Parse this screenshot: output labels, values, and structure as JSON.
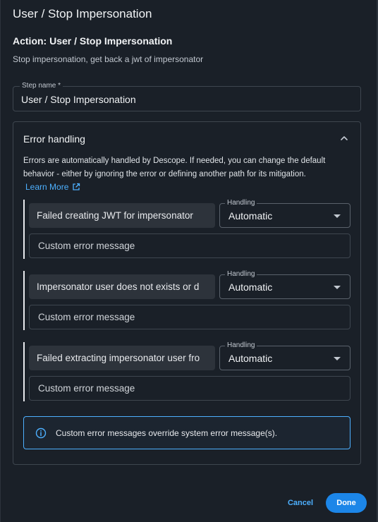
{
  "header": {
    "title": "User / Stop Impersonation",
    "action_title": "Action: User / Stop Impersonation",
    "action_description": "Stop impersonation, get back a jwt of impersonator"
  },
  "step": {
    "label": "Step name *",
    "value": "User / Stop Impersonation"
  },
  "error_handling": {
    "title": "Error handling",
    "description": "Errors are automatically handled by Descope. If needed, you can change the default behavior - either by ignoring the error or defining another path for its mitigation.",
    "learn_more": "Learn More",
    "errors": [
      {
        "message": "Failed creating JWT for impersonator",
        "handling_label": "Handling",
        "handling_value": "Automatic",
        "custom_placeholder": "Custom error message"
      },
      {
        "message": "Impersonator user does not exists or d",
        "handling_label": "Handling",
        "handling_value": "Automatic",
        "custom_placeholder": "Custom error message"
      },
      {
        "message": "Failed extracting impersonator user fro",
        "handling_label": "Handling",
        "handling_value": "Automatic",
        "custom_placeholder": "Custom error message"
      }
    ],
    "info": "Custom error messages override system error message(s)."
  },
  "footer": {
    "cancel_label": "Cancel",
    "done_label": "Done"
  },
  "icons": {
    "collapse": "chevron-up-icon",
    "external": "external-link-icon",
    "info": "info-icon",
    "dropdown": "caret-down-icon"
  },
  "colors": {
    "accent": "#4db0ff",
    "primary_button": "#1c86e8",
    "background": "#1a2028"
  }
}
